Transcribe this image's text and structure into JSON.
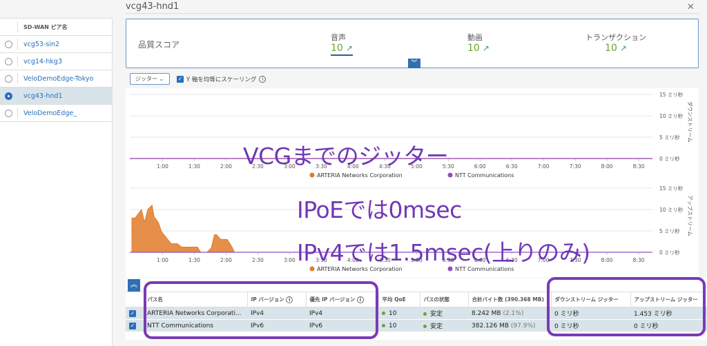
{
  "title": "vcg43-hnd1",
  "sidebar": {
    "column_header": "SD-WAN ピア名",
    "items": [
      {
        "label": "vcg53-sin2",
        "selected": false
      },
      {
        "label": "vcg14-hkg3",
        "selected": false
      },
      {
        "label": "VeloDemoEdge-Tokyo",
        "selected": false
      },
      {
        "label": "vcg43-hnd1",
        "selected": true
      },
      {
        "label": "VeloDemoEdge_",
        "selected": false
      }
    ]
  },
  "score": {
    "label": "品質スコア",
    "items": [
      {
        "label": "音声",
        "value": "10"
      },
      {
        "label": "動画",
        "value": "10"
      },
      {
        "label": "トランザクション",
        "value": "10"
      }
    ]
  },
  "toolbar": {
    "metric_dropdown": "ジッター ⌄",
    "scale_checkbox_label": "Y 軸を均等にスケーリング",
    "scale_checked": true
  },
  "colors": {
    "accent": "#2f6fb2",
    "arteria": "#e07b2a",
    "ntt": "#8e4fc0",
    "annotation": "#7038b5",
    "good": "#6ba32a"
  },
  "chart_data": [
    {
      "type": "line",
      "ylabel": "ダウンストリーム",
      "yticks": [
        "0 ミリ秒",
        "5 ミリ秒",
        "10 ミリ秒",
        "15 ミリ秒"
      ],
      "ylim": [
        0,
        15
      ],
      "xticks": [
        "1:00",
        "1:30",
        "2:00",
        "2:30",
        "3:00",
        "3:30",
        "4:00",
        "4:30",
        "5:00",
        "5:30",
        "6:00",
        "6:30",
        "7:00",
        "7:30",
        "8:00",
        "8:30"
      ],
      "xlim": [
        "0:29",
        "8:43"
      ],
      "grid": true,
      "legend": "bottom",
      "series": [
        {
          "name": "ARTERIA Networks Corporation",
          "x": [
            "0:29",
            "8:43"
          ],
          "values": [
            0,
            0
          ]
        },
        {
          "name": "NTT Communications",
          "x": [
            "0:29",
            "8:43"
          ],
          "values": [
            0,
            0
          ]
        }
      ]
    },
    {
      "type": "area",
      "ylabel": "アップストリーム",
      "yticks": [
        "0 ミリ秒",
        "5 ミリ秒",
        "10 ミリ秒",
        "15 ミリ秒"
      ],
      "ylim": [
        0,
        15
      ],
      "xticks": [
        "1:00",
        "1:30",
        "2:00",
        "2:30",
        "3:00",
        "3:30",
        "4:00",
        "4:30",
        "5:00",
        "5:30",
        "6:00",
        "6:30",
        "7:00",
        "7:30",
        "8:00",
        "8:30"
      ],
      "xlim": [
        "0:29",
        "8:43"
      ],
      "grid": true,
      "legend": "bottom",
      "series": [
        {
          "name": "ARTERIA Networks Corporation",
          "x": [
            "0:31",
            "0:34",
            "0:40",
            "0:43",
            "0:46",
            "0:50",
            "0:52",
            "0:56",
            "0:59",
            "1:08",
            "1:14",
            "1:18",
            "1:33",
            "1:36",
            "1:42",
            "1:46",
            "1:49",
            "1:51",
            "1:55",
            "2:01",
            "2:05",
            "2:08",
            "8:43"
          ],
          "values": [
            8,
            8,
            10,
            7,
            10,
            11,
            8.3,
            7,
            4.8,
            2,
            2,
            1.2,
            1.2,
            0,
            0,
            1,
            4.1,
            4.1,
            3,
            3,
            1.5,
            0,
            0
          ]
        },
        {
          "name": "NTT Communications",
          "x": [
            "0:29",
            "8:43"
          ],
          "values": [
            0,
            0
          ]
        }
      ]
    }
  ],
  "annotations": [
    "VCGまでのジッター",
    "IPoEでは0msec",
    "IPv4では1.5msec(上りのみ)"
  ],
  "table": {
    "headers": [
      "パス名",
      "IP バージョン",
      "優先 IP バージョン",
      "平均 QoE",
      "パスの状態",
      "合計バイト数 (390.368 MB)",
      "ダウンストリーム ジッター",
      "アップストリーム ジッター"
    ],
    "rows": [
      {
        "name": "ARTERIA Networks Corporati...",
        "ip": "IPv4",
        "pref_ip": "IPv4",
        "qoe": "10",
        "state": "安定",
        "bytes": "8.242 MB",
        "pct": "(2.1%)",
        "down": "0 ミリ秒",
        "up": "1.453 ミリ秒"
      },
      {
        "name": "NTT Communications",
        "ip": "IPv6",
        "pref_ip": "IPv6",
        "qoe": "10",
        "state": "安定",
        "bytes": "382.126 MB",
        "pct": "(97.9%)",
        "down": "0 ミリ秒",
        "up": "0 ミリ秒"
      }
    ]
  }
}
